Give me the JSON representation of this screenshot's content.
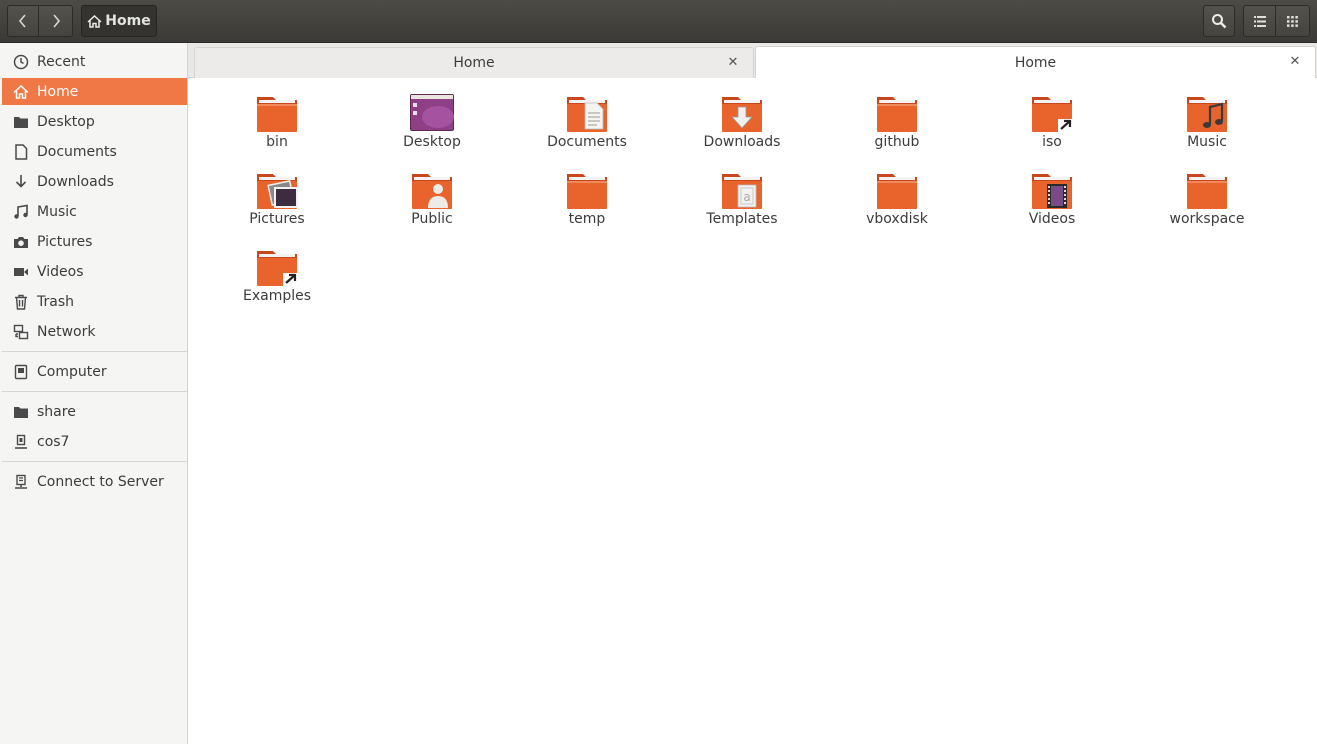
{
  "header": {
    "path_label": "Home",
    "back_icon": "chevron-left-icon",
    "forward_icon": "chevron-right-icon",
    "search_icon": "search-icon",
    "list_view_icon": "list-view-icon",
    "grid_view_icon": "grid-view-icon"
  },
  "colors": {
    "accent": "#f07746",
    "header_bg": "#3b3a36",
    "folder": "#e8642c"
  },
  "sidebar": {
    "items": [
      {
        "label": "Recent",
        "icon": "clock-icon"
      },
      {
        "label": "Home",
        "icon": "home-icon",
        "active": true
      },
      {
        "label": "Desktop",
        "icon": "folder-icon"
      },
      {
        "label": "Documents",
        "icon": "document-icon"
      },
      {
        "label": "Downloads",
        "icon": "download-icon"
      },
      {
        "label": "Music",
        "icon": "music-icon"
      },
      {
        "label": "Pictures",
        "icon": "camera-icon"
      },
      {
        "label": "Videos",
        "icon": "video-icon"
      },
      {
        "label": "Trash",
        "icon": "trash-icon"
      },
      {
        "label": "Network",
        "icon": "network-icon"
      },
      {
        "label": "Computer",
        "icon": "computer-icon"
      },
      {
        "label": "share",
        "icon": "folder-icon"
      },
      {
        "label": "cos7",
        "icon": "drive-icon"
      },
      {
        "label": "Connect to Server",
        "icon": "server-icon"
      }
    ]
  },
  "tabs": [
    {
      "label": "Home",
      "active": false
    },
    {
      "label": "Home",
      "active": true
    }
  ],
  "files": [
    {
      "name": "bin",
      "emblem": "none"
    },
    {
      "name": "Desktop",
      "emblem": "desktop"
    },
    {
      "name": "Documents",
      "emblem": "document"
    },
    {
      "name": "Downloads",
      "emblem": "download"
    },
    {
      "name": "github",
      "emblem": "none"
    },
    {
      "name": "iso",
      "emblem": "link"
    },
    {
      "name": "Music",
      "emblem": "music"
    },
    {
      "name": "Pictures",
      "emblem": "picture"
    },
    {
      "name": "Public",
      "emblem": "person"
    },
    {
      "name": "temp",
      "emblem": "none"
    },
    {
      "name": "Templates",
      "emblem": "template"
    },
    {
      "name": "vboxdisk",
      "emblem": "none"
    },
    {
      "name": "Videos",
      "emblem": "video"
    },
    {
      "name": "workspace",
      "emblem": "none"
    },
    {
      "name": "Examples",
      "emblem": "link"
    }
  ]
}
